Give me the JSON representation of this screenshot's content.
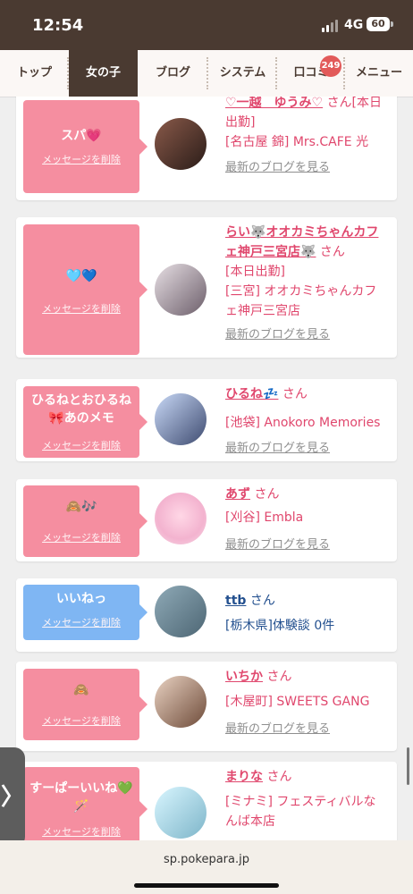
{
  "status": {
    "time": "12:54",
    "network": "4G",
    "battery": "60"
  },
  "nav": {
    "tabs": [
      "トップ",
      "女の子",
      "ブログ",
      "システム",
      "口コミ",
      "メニュー"
    ],
    "badge": "249"
  },
  "common": {
    "delete_label": "メッセージを削除",
    "blog_label": "最新のブログを見る",
    "san": "さん"
  },
  "cards": [
    {
      "message": "スパ💗",
      "name": "♡一越　ゆうみ♡",
      "san_line": "さん[本日出勤]",
      "shop": "[名古屋 錦] Mrs.CAFE 光"
    },
    {
      "message": "🩵💙",
      "name": "らい🐺オオカミちゃんカフェ神戸三宮店🐺",
      "status": "[本日出勤]",
      "shop": "[三宮] オオカミちゃんカフェ神戸三宮店"
    },
    {
      "message": "ひるねとおひるね🎀あのメモ",
      "name": "ひるね💤",
      "shop": "[池袋] Anokoro Memories"
    },
    {
      "message": "🙈🎶",
      "name": "あず",
      "shop": "[刈谷] Embla"
    },
    {
      "message": "いいねっ",
      "name": "ttb",
      "shop": "[栃木県]体験談 0件"
    },
    {
      "message": "🙈",
      "name": "いちか",
      "shop": "[木屋町] SWEETS GANG"
    },
    {
      "message": "すーぱーいいね💚🪄",
      "name": "まりな",
      "shop": "[ミナミ] フェスティバルなんば本店"
    }
  ],
  "side_tab": "〉",
  "url": "sp.pokepara.jp",
  "colors": {
    "brand": "#4a3a31",
    "pink": "#f58ea0",
    "blue": "#7fb6f3",
    "name_pink": "#e0476d",
    "name_blue": "#23508f"
  }
}
